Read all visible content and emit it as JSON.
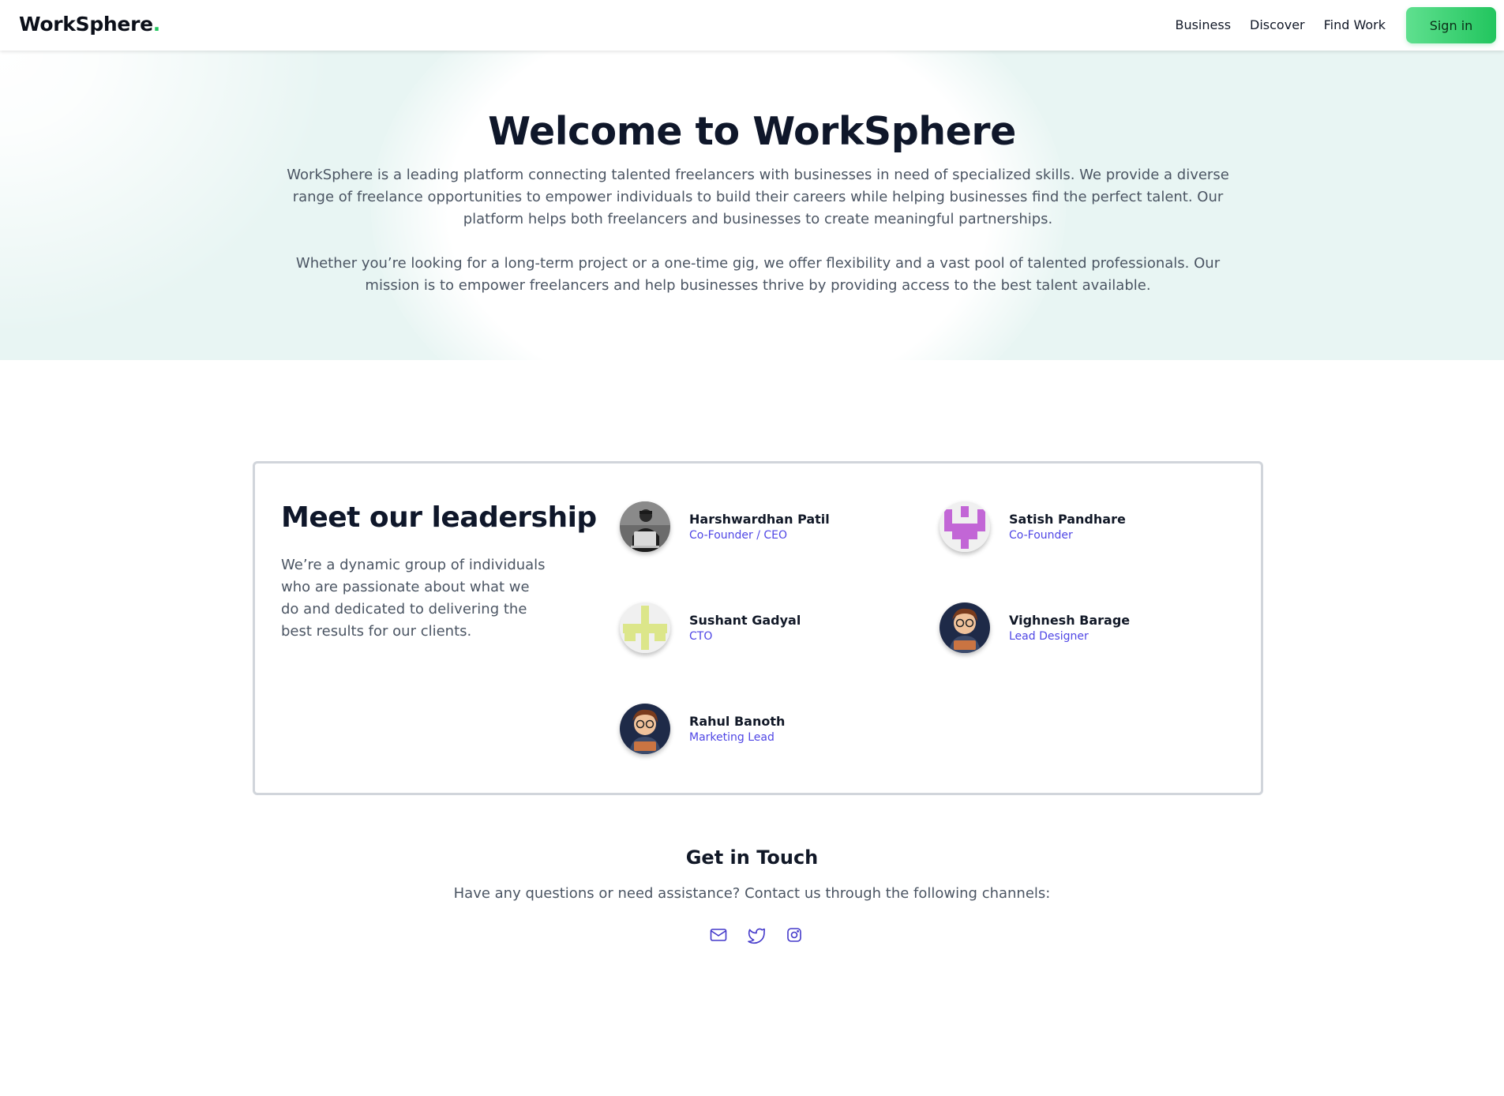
{
  "nav": {
    "brand": "WorkSphere",
    "brand_dot": ".",
    "links": [
      "Business",
      "Discover",
      "Find Work"
    ],
    "signin_label": "Sign in"
  },
  "hero": {
    "title": "Welcome to WorkSphere",
    "paragraph1": "WorkSphere is a leading platform connecting talented freelancers with businesses in need of specialized skills. We provide a diverse range of freelance opportunities to empower individuals to build their careers while helping businesses find the perfect talent. Our platform helps both freelancers and businesses to create meaningful partnerships.",
    "paragraph2": "Whether you’re looking for a long-term project or a one-time gig, we offer flexibility and a vast pool of talented professionals. Our mission is to empower freelancers and help businesses thrive by providing access to the best talent available."
  },
  "leadership": {
    "title": "Meet our leadership",
    "description": "We’re a dynamic group of individuals who are passionate about what we do and dedicated to delivering the best results for our clients.",
    "members": [
      {
        "name": "Harshwardhan Patil",
        "role": "Co-Founder / CEO",
        "avatar": "photo-person-laptop"
      },
      {
        "name": "Satish Pandhare",
        "role": "Co-Founder",
        "avatar": "identicon-purple"
      },
      {
        "name": "Sushant Gadyal",
        "role": "CTO",
        "avatar": "identicon-lime"
      },
      {
        "name": "Vighnesh Barage",
        "role": "Lead Designer",
        "avatar": "cartoon-boy"
      },
      {
        "name": "Rahul Banoth",
        "role": "Marketing Lead",
        "avatar": "cartoon-boy"
      }
    ]
  },
  "contact": {
    "title": "Get in Touch",
    "description": "Have any questions or need assistance? Contact us through the following channels:",
    "channels": [
      "mail-icon",
      "twitter-icon",
      "instagram-icon"
    ]
  },
  "colors": {
    "accent_green": "#22c55e",
    "role_indigo": "#4f46e5",
    "hero_bg": "#e8f5f3",
    "icon_indigo": "#4338ca"
  }
}
